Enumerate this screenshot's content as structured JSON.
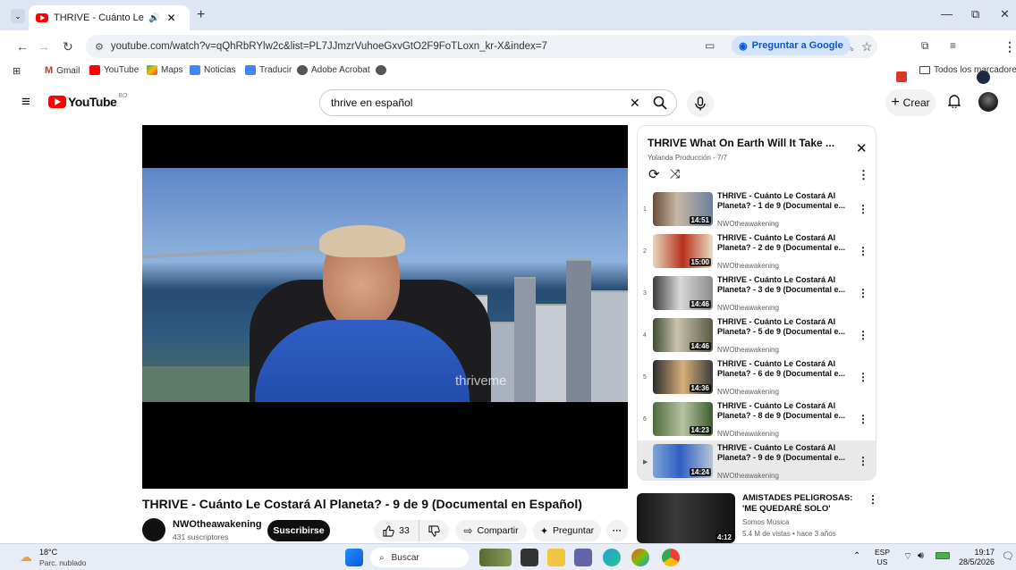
{
  "browser": {
    "tab": {
      "title": "THRIVE - Cuánto Le Costará",
      "sound": "🔊",
      "close": "✕"
    },
    "new_tab": "+",
    "window_controls": {
      "minimize": "—",
      "restore": "⧉",
      "close": "✕"
    },
    "url": "youtube.com/watch?v=qQhRbRYlw2c&list=PL7JJmzrVuhoeGxvGtO2F9FoTLoxn_kr-X&index=7",
    "ask_google": "Preguntar a Google"
  },
  "bookmarks": {
    "items": [
      "Gmail",
      "YouTube",
      "Maps",
      "Noticias",
      "Traducir",
      "Adobe Acrobat"
    ],
    "all_bookmarks": "Todos los marcadores"
  },
  "youtube": {
    "logo": "YouTube",
    "logo_country": "BO",
    "search_value": "thrive en español",
    "search_clear": "✕",
    "create_label": "Crear"
  },
  "video": {
    "title": "THRIVE - Cuánto Le Costará Al Planeta? - 9 de 9 (Documental en Español)",
    "watermark": "thriveme",
    "channel": "NWOtheawakening",
    "subscribers": "431 suscriptores",
    "subscribe_label": "Suscribirse",
    "likes": "33",
    "share_label": "Compartir",
    "ask_label": "Preguntar",
    "more": "···"
  },
  "playlist": {
    "title": "THRIVE What On Earth Will It Take ...",
    "subtitle": "Yolanda Producción - 7/7",
    "items": [
      {
        "num": "1",
        "title": "THRIVE - Cuánto Le Costará Al Planeta? - 1 de 9 (Documental e...",
        "channel": "NWOtheawakening",
        "duration": "14:51"
      },
      {
        "num": "2",
        "title": "THRIVE - Cuánto Le Costará Al Planeta? - 2 de 9 (Documental e...",
        "channel": "NWOtheawakening",
        "duration": "15:00"
      },
      {
        "num": "3",
        "title": "THRIVE - Cuánto Le Costará Al Planeta? - 3 de 9 (Documental e...",
        "channel": "NWOtheawakening",
        "duration": "14:46"
      },
      {
        "num": "4",
        "title": "THRIVE - Cuánto Le Costará Al Planeta? - 5 de 9 (Documental e...",
        "channel": "NWOtheawakening",
        "duration": "14:46"
      },
      {
        "num": "5",
        "title": "THRIVE - Cuánto Le Costará Al Planeta? - 6 de 9 (Documental e...",
        "channel": "NWOtheawakening",
        "duration": "14:36"
      },
      {
        "num": "6",
        "title": "THRIVE - Cuánto Le Costará Al Planeta? - 8 de 9 (Documental e...",
        "channel": "NWOtheawakening",
        "duration": "14:23"
      },
      {
        "num": "▶",
        "title": "THRIVE - Cuánto Le Costará Al Planeta? - 9 de 9 (Documental e...",
        "channel": "NWOtheawakening",
        "duration": "14:24"
      }
    ]
  },
  "recommended": {
    "title": "AMISTADES PELIGROSAS: 'ME QUEDARÉ SOLO'",
    "channel": "Somos Música",
    "meta": "5.4 M de vistas • hace 3 años",
    "duration": "4:12"
  },
  "taskbar": {
    "temp": "18°C",
    "weather": "Parc. nublado",
    "search": "Buscar",
    "lang_top": "ESP",
    "lang_bottom": "US",
    "time": "19:17",
    "date": "28/5/2026"
  }
}
